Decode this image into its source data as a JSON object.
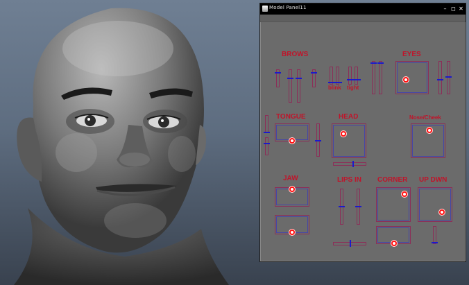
{
  "window": {
    "title": "Model Panel11",
    "buttons": {
      "minimize": "–",
      "maximize": "◻",
      "close": "✕"
    }
  },
  "sections": {
    "brows": "BROWS",
    "eyes": "EYES",
    "blink": "blink",
    "tight": "tight",
    "tongue": "TONGUE",
    "head": "HEAD",
    "nose_cheek": "Nose/Cheek",
    "jaw": "JAW",
    "lips_in": "LIPS IN",
    "corner": "CORNER",
    "up_dwn": "UP DWN"
  },
  "colors": {
    "label_red": "#c0142a",
    "control_blue": "#1a1acc",
    "knob_red": "#ff1010",
    "viewport_top": "#6f7f93"
  }
}
